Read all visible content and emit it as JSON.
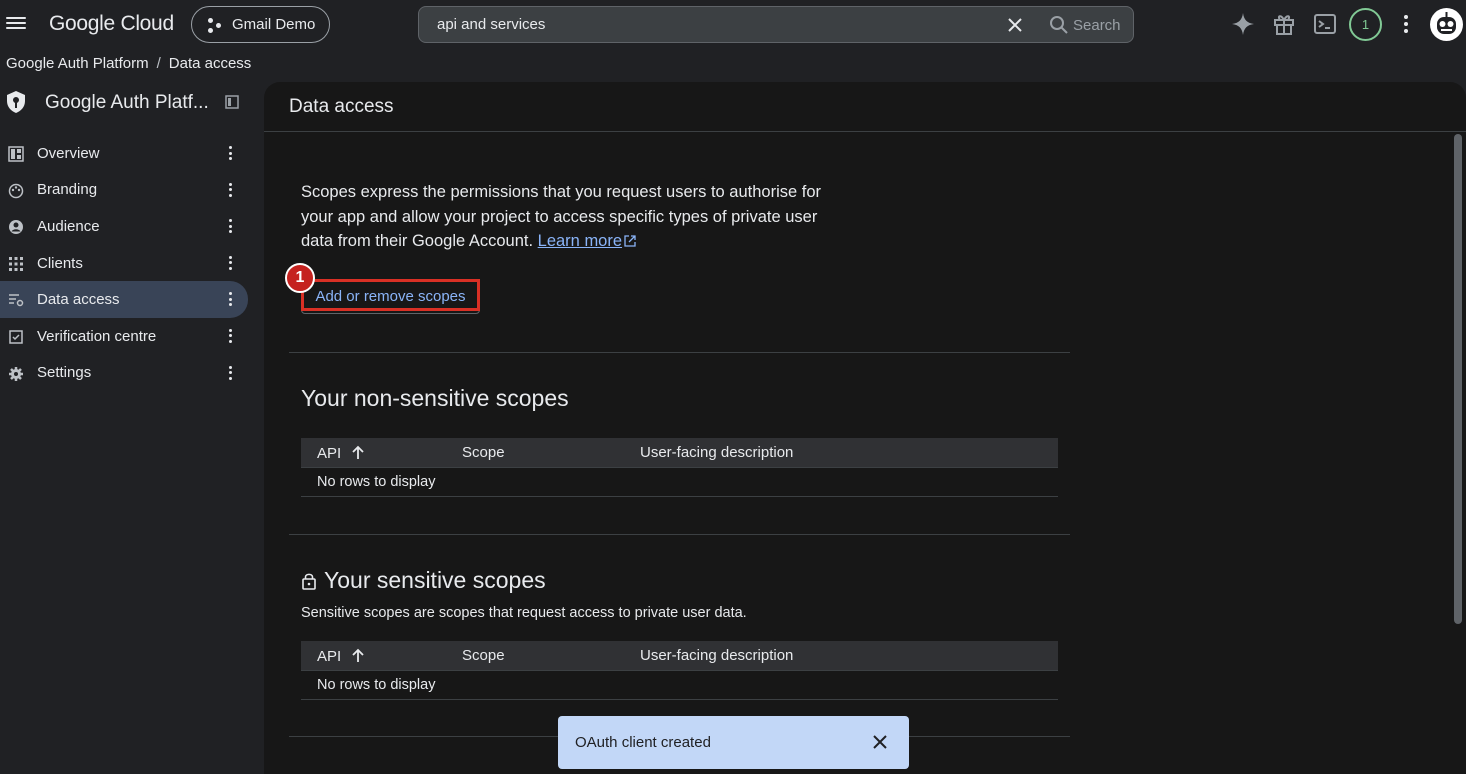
{
  "topbar": {
    "logo": "Google Cloud",
    "project": "Gmail Demo",
    "search_value": "api and services",
    "search_label": "Search",
    "notification_count": "1"
  },
  "breadcrumb": [
    "Google Auth Platform",
    "Data access"
  ],
  "breadcrumb_sep": "/",
  "sidebar": {
    "title": "Google Auth Platf...",
    "items": [
      {
        "label": "Overview",
        "icon": "dashboard-icon"
      },
      {
        "label": "Branding",
        "icon": "palette-icon"
      },
      {
        "label": "Audience",
        "icon": "account-circle-icon"
      },
      {
        "label": "Clients",
        "icon": "apps-grid-icon"
      },
      {
        "label": "Data access",
        "icon": "data-settings-icon",
        "active": true
      },
      {
        "label": "Verification centre",
        "icon": "checkbox-icon"
      },
      {
        "label": "Settings",
        "icon": "gear-icon"
      }
    ]
  },
  "main": {
    "title": "Data access",
    "intro": "Scopes express the permissions that you request users to authorise for your app and allow your project to access specific types of private user data from their Google Account.",
    "learn_more": "Learn more",
    "add_button": "Add or remove scopes",
    "marker": "1",
    "non_sensitive": {
      "title": "Your non-sensitive scopes",
      "columns": [
        "API",
        "Scope",
        "User-facing description"
      ],
      "empty": "No rows to display"
    },
    "sensitive": {
      "title": "Your sensitive scopes",
      "subtitle": "Sensitive scopes are scopes that request access to private user data.",
      "columns": [
        "API",
        "Scope",
        "User-facing description"
      ],
      "empty": "No rows to display"
    }
  },
  "toast": {
    "message": "OAuth client created"
  },
  "colors": {
    "accent": "#8ab4f8",
    "active_nav": "#394457",
    "highlight": "#d93025",
    "toast_bg": "#c2d7f7"
  }
}
